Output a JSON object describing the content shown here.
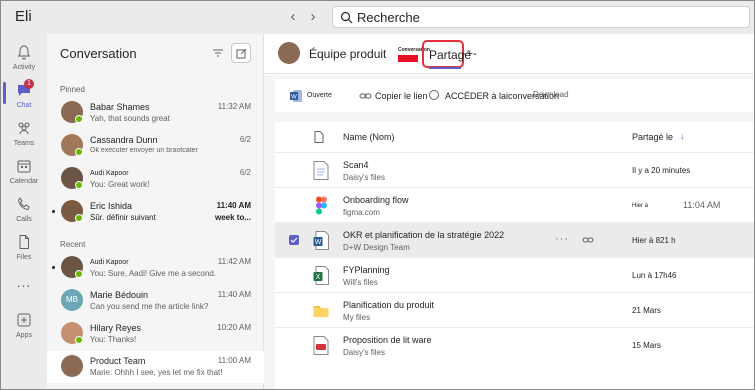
{
  "app": {
    "title": "Eli"
  },
  "search": {
    "text": "Recherche"
  },
  "rail": [
    {
      "label": "Activity",
      "icon": "bell-icon"
    },
    {
      "label": "Chat",
      "icon": "chat-icon",
      "badge": "1",
      "active": true
    },
    {
      "label": "Teams",
      "icon": "teams-icon"
    },
    {
      "label": "Calendar",
      "icon": "calendar-icon"
    },
    {
      "label": "Calls",
      "icon": "phone-icon"
    },
    {
      "label": "Files",
      "icon": "file-icon"
    },
    {
      "label": "Apps",
      "icon": "apps-icon"
    }
  ],
  "rail_more": "...",
  "chatlist": {
    "title": "Conversation",
    "pinned_label": "Pinned",
    "recent_label": "Recent",
    "pinned": [
      {
        "name": "Babar Shames",
        "preview": "Yah, that sounds great",
        "time": "11:32 AM",
        "avatar_color": "#8a6a55"
      },
      {
        "name": "Cassandra Dunn",
        "preview": "Ok exécuter envoyer un braotcater",
        "time": "6/2",
        "avatar_color": "#a0785a"
      },
      {
        "name": "Audi Kapoor",
        "preview": "You: Great work!",
        "time": "6/2",
        "avatar_color": "#6b5544"
      },
      {
        "name": "Eric Ishida",
        "preview": "Sûr. définir suivant",
        "time": "11:40 AM",
        "right2": "week to...",
        "avatar_color": "#7a5a42"
      }
    ],
    "recent": [
      {
        "name": "Audi Kapoor",
        "preview": "You: Sure, Aadi! Give me a second.",
        "time": "11:42 AM",
        "avatar_color": "#6b5544"
      },
      {
        "name": "Marie Bédouin",
        "preview": "Can you send me the article link?",
        "time": "11:40 AM",
        "initials": "MB",
        "avatar_color": "#6ba7b5"
      },
      {
        "name": "Hilary Reyes",
        "preview": "You: Thanks!",
        "time": "10:20 AM",
        "avatar_color": "#c49070"
      },
      {
        "name": "Product Team",
        "preview": "Marie: Ohhh I see, yes let me fix that!",
        "time": "11:00 AM",
        "avatar_color": "#8a6a55"
      }
    ]
  },
  "main": {
    "group_name": "Équipe produit",
    "tab_conversation": "Conversation",
    "tab_shared": "Partagé",
    "tab_extra": "-+-",
    "toolbar": {
      "open": "Ouverte",
      "copy_link": "Copier le lien",
      "goto": "ACCÉDER à laiconversation",
      "download": "Download"
    },
    "columns": {
      "name": "Name (Nom)",
      "shared": "Partagé le",
      "sort": "↓"
    },
    "files": [
      {
        "name": "Scan4",
        "sub": "Daisy's files",
        "shared": "Il y a 20 minutes",
        "type": "doc"
      },
      {
        "name": "Onboarding flow",
        "sub": "figma.com",
        "shared": "Hier à",
        "extra": "11:04 AM",
        "type": "figma",
        "shared_small": true
      },
      {
        "name": "OKR et planification de la stratégie 2022",
        "sub": "D+W Design Team",
        "shared": "Hier à 821 h",
        "type": "word",
        "selected": true
      },
      {
        "name": "FYPlanning",
        "sub": "Will's files",
        "shared": "Lun à 17h46",
        "type": "excel"
      },
      {
        "name": "Planification du produit",
        "sub": "My files",
        "shared": "21 Mars",
        "type": "folder"
      },
      {
        "name": "Proposition de lit ware",
        "sub": "Daisy's files",
        "shared": "15 Mars",
        "type": "pdf"
      }
    ]
  },
  "colors": {
    "accent": "#5b5fc7",
    "highlight": "#e3323b",
    "presence": "#6bb700"
  }
}
